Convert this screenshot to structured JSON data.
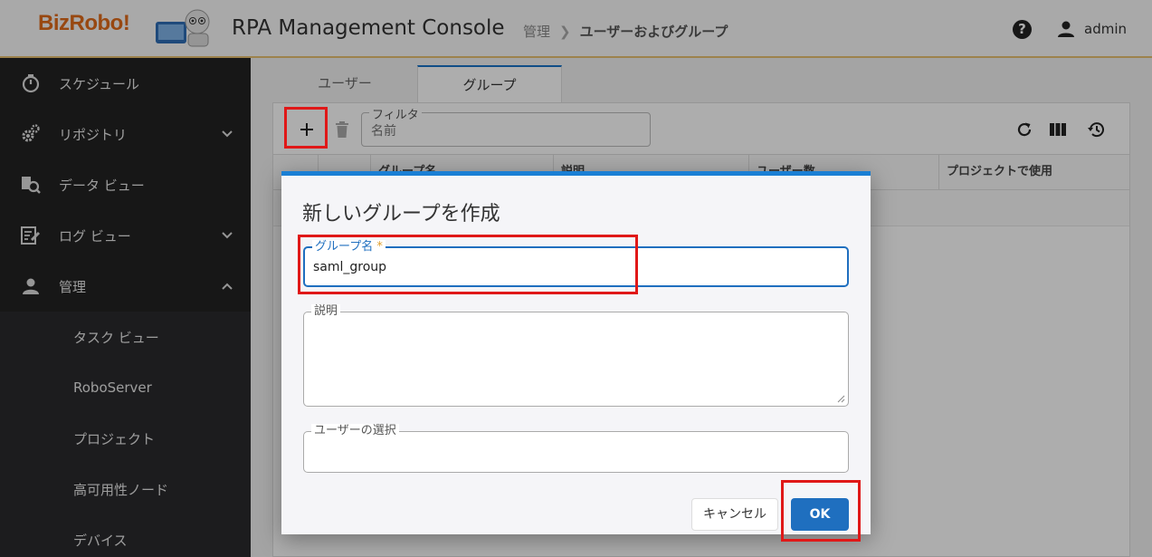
{
  "header": {
    "logo": "BizRobo!",
    "app_title": "RPA Management Console",
    "breadcrumb": [
      "管理",
      "ユーザーおよびグループ"
    ],
    "user": "admin"
  },
  "sidebar": {
    "items": [
      {
        "label": "スケジュール"
      },
      {
        "label": "リポジトリ"
      },
      {
        "label": "データ ビュー"
      },
      {
        "label": "ログ ビュー"
      },
      {
        "label": "管理"
      }
    ],
    "subitems": [
      {
        "label": "タスク ビュー"
      },
      {
        "label": "RoboServer"
      },
      {
        "label": "プロジェクト"
      },
      {
        "label": "高可用性ノード"
      },
      {
        "label": "デバイス"
      }
    ]
  },
  "tabs": [
    {
      "label": "ユーザー"
    },
    {
      "label": "グループ"
    }
  ],
  "filter": {
    "label": "フィルタ",
    "placeholder": "名前"
  },
  "table": {
    "columns": [
      "グループ名",
      "説明",
      "ユーザー数",
      "プロジェクトで使用"
    ]
  },
  "dialog": {
    "title": "新しいグループを作成",
    "group_name_label": "グループ名",
    "required_mark": "*",
    "group_name_value": "saml_group",
    "description_label": "説明",
    "users_label": "ユーザーの選択",
    "cancel_label": "キャンセル",
    "ok_label": "OK"
  },
  "colors": {
    "accent": "#1f6fbf",
    "dialog_top_bar": "#1a7fd4",
    "sidebar_bg": "#222222",
    "highlight": "#e01818",
    "logo": "#e06a1a"
  }
}
